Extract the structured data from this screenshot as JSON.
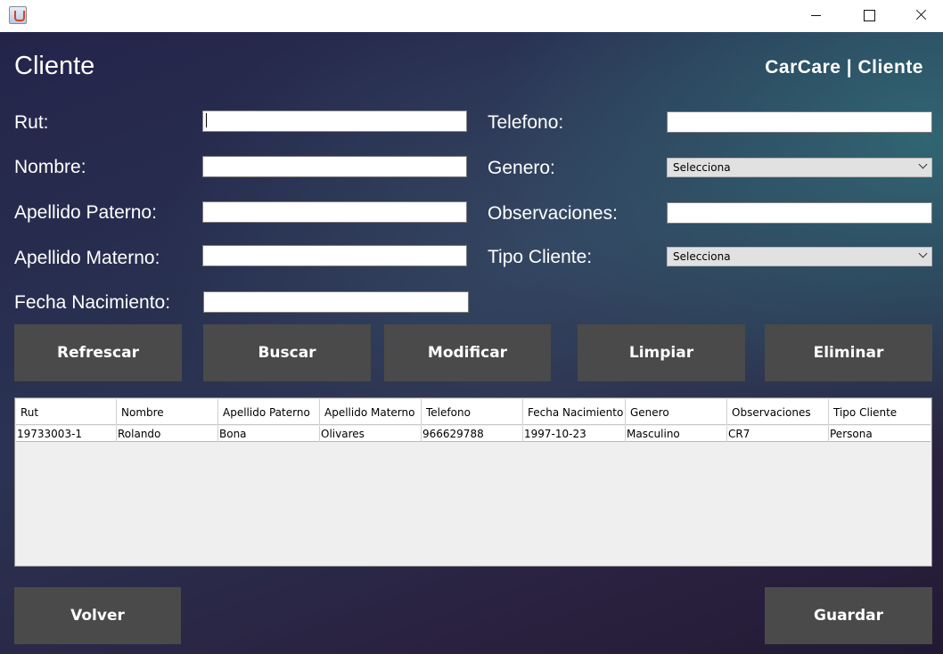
{
  "window": {
    "icon": "java-cup-icon"
  },
  "header": {
    "title": "Cliente",
    "brand": "CarCare | Cliente"
  },
  "form": {
    "rut_label": "Rut:",
    "nombre_label": "Nombre:",
    "apellido_paterno_label": "Apellido Paterno:",
    "apellido_materno_label": "Apellido Materno:",
    "fecha_nacimiento_label": "Fecha Nacimiento:",
    "telefono_label": "Telefono:",
    "genero_label": "Genero:",
    "observaciones_label": "Observaciones:",
    "tipo_cliente_label": "Tipo Cliente:",
    "rut_value": "",
    "nombre_value": "",
    "apellido_paterno_value": "",
    "apellido_materno_value": "",
    "fecha_nacimiento_value": "",
    "telefono_value": "",
    "observaciones_value": "",
    "genero_selected": "Selecciona",
    "tipo_cliente_selected": "Selecciona"
  },
  "actions": {
    "refrescar": "Refrescar",
    "buscar": "Buscar",
    "modificar": "Modificar",
    "limpiar": "Limpiar",
    "eliminar": "Eliminar",
    "volver": "Volver",
    "guardar": "Guardar"
  },
  "table": {
    "columns": [
      "Rut",
      "Nombre",
      "Apellido Paterno",
      "Apellido Materno",
      "Telefono",
      "Fecha Nacimiento",
      "Genero",
      "Observaciones",
      "Tipo Cliente"
    ],
    "rows": [
      [
        "19733003-1",
        "Rolando",
        "Bona",
        "Olivares",
        "966629788",
        "1997-10-23",
        "Masculino",
        "CR7",
        "Persona"
      ]
    ]
  },
  "colors": {
    "button_bg": "#4a4a4a",
    "text": "#ffffff",
    "accent_teal": "#326e78"
  }
}
